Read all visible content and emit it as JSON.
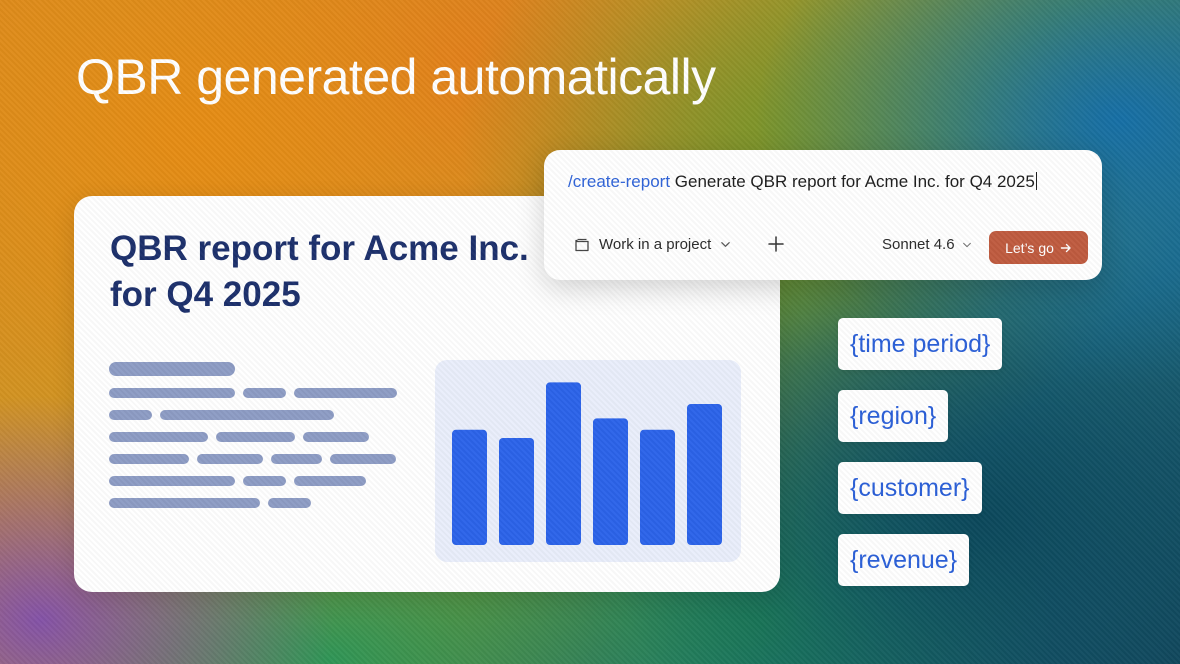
{
  "headline": "QBR generated automatically",
  "report": {
    "title_line1": "QBR report for Acme Inc.",
    "title_line2": "for Q4 2025"
  },
  "chart_data": {
    "type": "bar",
    "categories": [
      "",
      "",
      "",
      "",
      "",
      ""
    ],
    "values": [
      112,
      104,
      158,
      123,
      112,
      137
    ],
    "ylim": [
      0,
      170
    ],
    "bar_color": "#2b63e9",
    "panel_color": "#e9eefb"
  },
  "prompt": {
    "command": "/create-report",
    "text": "Generate QBR report for Acme Inc. for Q4 2025",
    "project_label": "Work in a project",
    "model_label": "Sonnet 4.6",
    "go_label": "Let’s go"
  },
  "variables": [
    "{time period}",
    "{region}",
    "{customer}",
    "{revenue}"
  ],
  "colors": {
    "title": "#1c2f6b",
    "accent_blue": "#2f63d8",
    "button": "#bf5b3f",
    "skeleton": "#8d9cc4"
  },
  "icons": {
    "project": "folder-icon",
    "add": "plus-icon",
    "dropdown": "chevron-down-icon",
    "submit": "arrow-right-icon"
  }
}
